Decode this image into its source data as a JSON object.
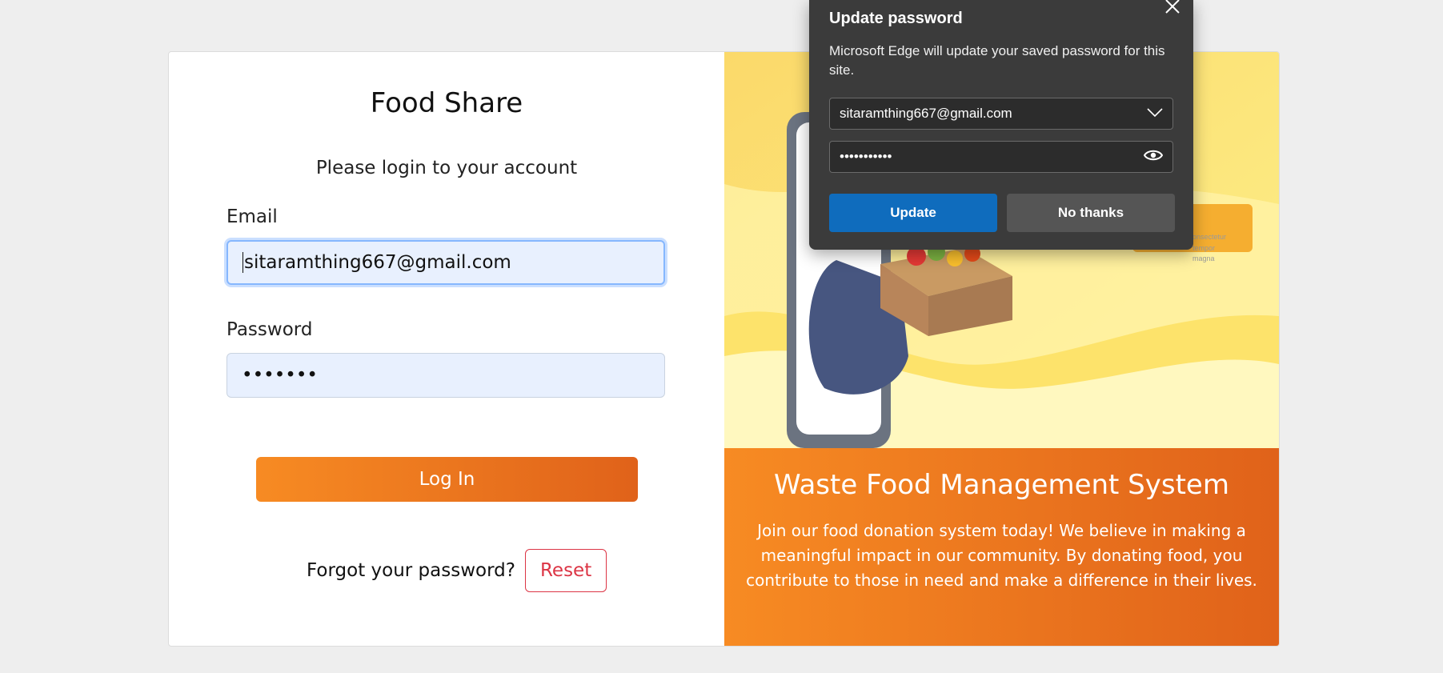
{
  "app": {
    "title": "Food Share",
    "subtitle": "Please login to your account"
  },
  "form": {
    "email_label": "Email",
    "email_value": "sitaramthing667@gmail.com",
    "password_label": "Password",
    "password_masked": "•••••••",
    "login_label": "Log In",
    "forgot_text": "Forgot your password?",
    "reset_label": "Reset"
  },
  "promo": {
    "title": "Waste Food Management System",
    "text": "Join our food donation system today! We believe in making a meaningful impact in our community. By donating food, you contribute to those in need and make a difference in their lives."
  },
  "popup": {
    "title": "Update password",
    "description": "Microsoft Edge will update your saved password for this site.",
    "username_value": "sitaramthing667@gmail.com",
    "password_masked": "•••••••••••",
    "update_label": "Update",
    "no_thanks_label": "No thanks"
  },
  "colors": {
    "accent_orange": "#f78b23",
    "accent_orange_dark": "#e0621a",
    "danger": "#dc3545",
    "edge_blue": "#0f6cbd",
    "popup_bg": "#3b3b3b"
  },
  "icons": [
    "close-icon",
    "chevron-down-icon",
    "eye-icon"
  ]
}
